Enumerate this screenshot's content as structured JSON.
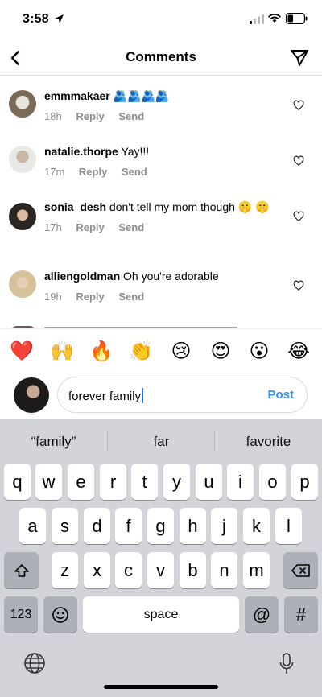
{
  "status": {
    "time": "3:58"
  },
  "header": {
    "title": "Comments"
  },
  "comments": [
    {
      "username": "emmmakaer",
      "text": "🫂🫂🫂🫂",
      "time": "18h",
      "reply": "Reply",
      "send": "Send"
    },
    {
      "username": "natalie.thorpe",
      "text": "Yay!!!",
      "time": "17m",
      "reply": "Reply",
      "send": "Send"
    },
    {
      "username": "sonia_desh",
      "text": "don't tell my mom though 🤫 🤫",
      "time": "17h",
      "reply": "Reply",
      "send": "Send"
    },
    {
      "username": "alliengoldman",
      "text": "Oh you're adorable",
      "time": "19h",
      "reply": "Reply",
      "send": "Send"
    }
  ],
  "emoji_bar": [
    "❤️",
    "🙌",
    "🔥",
    "👏",
    "😢",
    "😍",
    "😮",
    "😂"
  ],
  "composer": {
    "value": "forever family",
    "post_label": "Post"
  },
  "keyboard": {
    "suggestions": [
      "“family”",
      "far",
      "favorite"
    ],
    "row1": [
      "q",
      "w",
      "e",
      "r",
      "t",
      "y",
      "u",
      "i",
      "o",
      "p"
    ],
    "row2": [
      "a",
      "s",
      "d",
      "f",
      "g",
      "h",
      "j",
      "k",
      "l"
    ],
    "row3": [
      "z",
      "x",
      "c",
      "v",
      "b",
      "n",
      "m"
    ],
    "numbers_key": "123",
    "space_key": "space",
    "at_key": "@",
    "hash_key": "#"
  },
  "colors": {
    "post": "#2f96f0",
    "caret": "#1a6ff7",
    "keyboard_bg": "#d2d4d9"
  },
  "icons": [
    "location-arrow-icon",
    "signal-icon",
    "wifi-icon",
    "battery-icon",
    "back-chevron-icon",
    "send-paper-plane-icon",
    "heart-icon",
    "shift-icon",
    "backspace-icon",
    "emoji-icon",
    "globe-icon",
    "microphone-icon"
  ]
}
